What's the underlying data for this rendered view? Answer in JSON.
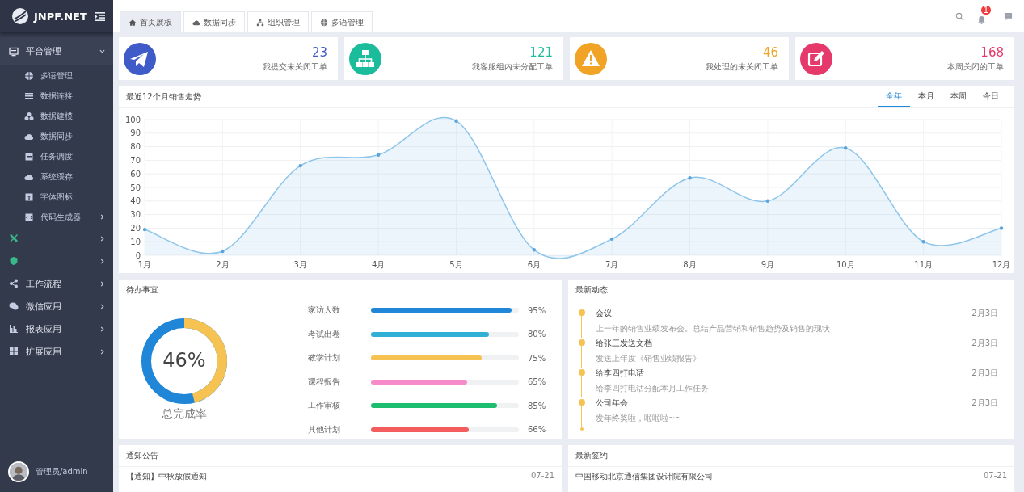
{
  "sidebar": {
    "brand": "JNPF.NET",
    "group": {
      "label": "平台管理",
      "expanded": true,
      "children": [
        {
          "label": "多语管理"
        },
        {
          "label": "数据连接"
        },
        {
          "label": "数据建模"
        },
        {
          "label": "数据同步"
        },
        {
          "label": "任务调度"
        },
        {
          "label": "系统缓存"
        },
        {
          "label": "字体图标"
        },
        {
          "label": "代码生成器",
          "has_children": true
        }
      ]
    },
    "items": [
      {
        "label": "工作流程"
      },
      {
        "label": "微信应用"
      },
      {
        "label": "报表应用"
      },
      {
        "label": "扩展应用"
      }
    ],
    "user": "管理员/admin"
  },
  "tabs": [
    {
      "label": "首页展板",
      "selected": true
    },
    {
      "label": "数据同步",
      "selected": false
    },
    {
      "label": "组织管理",
      "selected": false
    },
    {
      "label": "多语管理",
      "selected": false
    }
  ],
  "notifications": {
    "badge": "1"
  },
  "stats": [
    {
      "value": "23",
      "label": "我提交未关闭工单",
      "color": "#3f5bc7"
    },
    {
      "value": "121",
      "label": "我客服组内未分配工单",
      "color": "#1bbc9b"
    },
    {
      "value": "46",
      "label": "我处理的未关闭工单",
      "color": "#f1a325"
    },
    {
      "value": "168",
      "label": "本周关闭的工单",
      "color": "#e6396b"
    }
  ],
  "sales": {
    "title": "最近12个月销售走势",
    "ranges": [
      {
        "label": "全年",
        "selected": true
      },
      {
        "label": "本月",
        "selected": false
      },
      {
        "label": "本周",
        "selected": false
      },
      {
        "label": "今日",
        "selected": false
      }
    ],
    "chart_data": {
      "type": "area",
      "categories": [
        "1月",
        "2月",
        "3月",
        "4月",
        "5月",
        "6月",
        "7月",
        "8月",
        "9月",
        "10月",
        "11月",
        "12月"
      ],
      "grid": true,
      "series": [
        {
          "color": "#8ec5ea",
          "values": [
            19,
            3,
            66,
            74,
            99,
            4,
            12,
            57,
            40,
            79,
            10,
            20
          ]
        }
      ],
      "ylim": [
        0,
        100
      ],
      "yticks": [
        0,
        10,
        20,
        30,
        40,
        50,
        60,
        70,
        80,
        90,
        100
      ]
    }
  },
  "todo": {
    "title": "待办事宜",
    "ring": {
      "value": "46%",
      "label": "总完成率",
      "level": 0.46
    },
    "tasks": [
      {
        "name": "家访人数",
        "level": 0.95,
        "reading": "95%",
        "color": "#1f86d8"
      },
      {
        "name": "考试出卷",
        "level": 0.8,
        "reading": "80%",
        "color": "#31b0d5"
      },
      {
        "name": "教学计划",
        "level": 0.75,
        "reading": "75%",
        "color": "#f6c352"
      },
      {
        "name": "课程报告",
        "level": 0.65,
        "reading": "65%",
        "color": "#f78bc9"
      },
      {
        "name": "工作审核",
        "level": 0.85,
        "reading": "85%",
        "color": "#1dbd6f"
      },
      {
        "name": "其他计划",
        "level": 0.66,
        "reading": "66%",
        "color": "#f35d5d"
      }
    ]
  },
  "news": {
    "title": "最新动态",
    "events": [
      {
        "title": "会议",
        "desc": "上一年的销售业绩发布会。总结产品营销和销售趋势及销售的现状",
        "date": "2月3日"
      },
      {
        "title": "给张三发送文档",
        "desc": "发送上年度《销售业绩报告》",
        "date": "2月3日"
      },
      {
        "title": "给李四打电话",
        "desc": "给李四打电话分配本月工作任务",
        "date": "2月3日"
      },
      {
        "title": "公司年会",
        "desc": "发年终奖啦，啦啦啦~~",
        "date": "2月3日"
      }
    ]
  },
  "notices": {
    "title": "通知公告",
    "rows": [
      {
        "text": "【通知】中秋放假通知",
        "date": "07-21"
      }
    ]
  },
  "contracts": {
    "title": "最新签约",
    "rows": [
      {
        "text": "中国移动北京通信集团设计院有限公司",
        "date": "07-21"
      }
    ]
  }
}
